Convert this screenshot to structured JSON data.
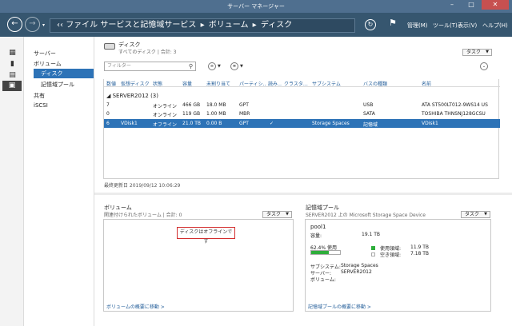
{
  "window": {
    "title": "サーバー マネージャー",
    "min_icon": "minimize-icon",
    "max_icon": "maximize-icon",
    "close_icon": "close-icon",
    "close_glyph": "✕"
  },
  "nav": {
    "back_icon": "back-arrow-icon",
    "forward_icon": "forward-arrow-icon",
    "breadcrumb_prefix": "‹‹",
    "breadcrumb": [
      "ファイル サービスと記憶域サービス",
      "ボリューム",
      "ディスク"
    ],
    "separator": "▸",
    "refresh_icon": "refresh-icon",
    "flag_icon": "flag-icon",
    "menus": [
      "管理(M)",
      "ツール(T)",
      "表示(V)",
      "ヘルプ(H)"
    ]
  },
  "sidebar_icons": [
    "dashboard-icon",
    "local-server-icon",
    "all-servers-icon",
    "file-storage-services-icon"
  ],
  "sidebar": {
    "items": [
      {
        "label": "サーバー",
        "level": 0
      },
      {
        "label": "ボリューム",
        "level": 0
      },
      {
        "label": "ディスク",
        "level": 1,
        "selected": true
      },
      {
        "label": "記憶域プール",
        "level": 1
      },
      {
        "label": "共有",
        "level": 0
      },
      {
        "label": "iSCSI",
        "level": 0
      }
    ]
  },
  "disks": {
    "title": "ディスク",
    "subtitle": "すべてのディスク | 合計: 3",
    "task_label": "タスク",
    "filter_placeholder": "フィルター",
    "columns": [
      "数値",
      "仮想ディスク",
      "状態",
      "容量",
      "未割り当て",
      "パーティシ…",
      "読み…",
      "クラスタ…",
      "サブシステム",
      "バスの種類",
      "名前"
    ],
    "group": "SERVER2012 (3)",
    "rows": [
      [
        "7",
        "",
        "オンライン",
        "466 GB",
        "18.0 MB",
        "GPT",
        "",
        "",
        "",
        "USB",
        "ATA ST500LT012-9WS14 US"
      ],
      [
        "0",
        "",
        "オンライン",
        "119 GB",
        "1.00 MB",
        "MBR",
        "",
        "",
        "",
        "SATA",
        "TOSHIBA THNSNJ128GCSU"
      ],
      [
        "6",
        "VDisk1",
        "オフライン",
        "21.0 TB",
        "0.00 B",
        "GPT",
        "✓",
        "",
        "Storage Spaces",
        "記憶域",
        "VDisk1"
      ]
    ],
    "selected_row": 2,
    "last_updated": "最終更新日 2019/09/12 10:06:29"
  },
  "volumes": {
    "title": "ボリューム",
    "subtitle": "関連付けられたボリューム | 合計: 0",
    "task_label": "タスク",
    "empty_message": "ディスクはオフラインです",
    "link": "ボリュームの概要に移動 >"
  },
  "pool": {
    "title": "記憶域プール",
    "subtitle": "SERVER2012 上の Microsoft Storage Space Device",
    "task_label": "タスク",
    "name": "pool1",
    "capacity_label": "容量:",
    "capacity": "19.1 TB",
    "usage_text": "62.4% 使用",
    "usage_fraction": 0.624,
    "used_label": "使用領域:",
    "used_value": "11.9 TB",
    "free_label": "空き領域:",
    "free_value": "7.18 TB",
    "subsystem_label": "サブシステム:",
    "subsystem": "Storage Spaces",
    "server_label": "サーバー:",
    "server": "SERVER2012",
    "volume_label": "ボリューム:",
    "link": "記憶域プールの概要に移動 >",
    "used_color": "#2eae3b",
    "free_color": "#ffffff"
  },
  "colors": {
    "accent": "#2d73b7",
    "titlebar": "#4f6f8f",
    "navbar": "#36566f",
    "alert": "#d32f2f"
  }
}
